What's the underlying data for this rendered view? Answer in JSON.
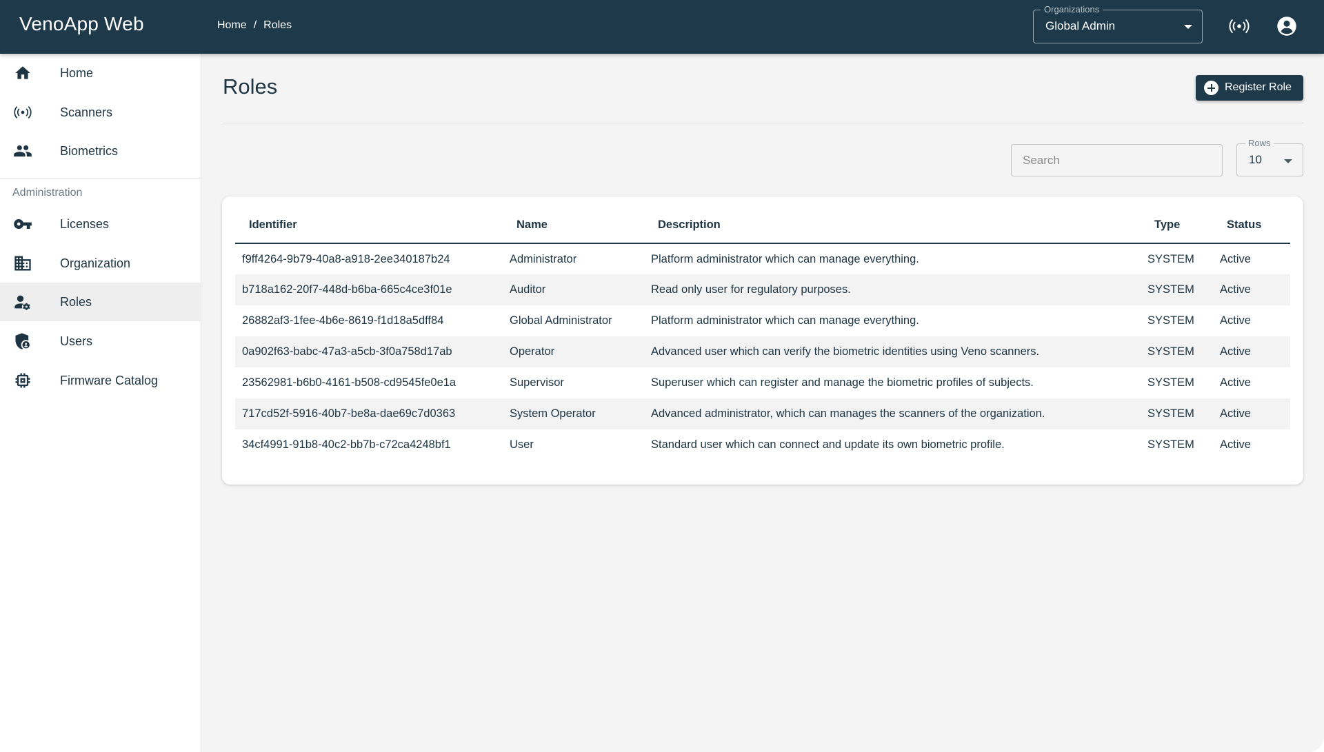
{
  "app": {
    "title": "VenoApp Web"
  },
  "breadcrumb": {
    "items": [
      "Home",
      "Roles"
    ],
    "separator": "/"
  },
  "org_select": {
    "legend": "Organizations",
    "value": "Global Admin"
  },
  "topbar_icons": [
    "scanner-signal-icon",
    "account-circle-icon"
  ],
  "sidebar": {
    "items": [
      {
        "label": "Home",
        "icon": "home-icon"
      },
      {
        "label": "Scanners",
        "icon": "scanner-signal-icon"
      },
      {
        "label": "Biometrics",
        "icon": "people-icon"
      }
    ],
    "section_label": "Administration",
    "admin_items": [
      {
        "label": "Licenses",
        "icon": "key-icon"
      },
      {
        "label": "Organization",
        "icon": "building-icon"
      },
      {
        "label": "Roles",
        "icon": "user-gear-icon",
        "active": true
      },
      {
        "label": "Users",
        "icon": "shield-user-icon"
      },
      {
        "label": "Firmware Catalog",
        "icon": "chip-icon"
      }
    ]
  },
  "page": {
    "title": "Roles",
    "register_button": "Register Role",
    "search_placeholder": "Search",
    "rows_legend": "Rows",
    "rows_value": "10"
  },
  "table": {
    "headers": [
      "Identifier",
      "Name",
      "Description",
      "Type",
      "Status"
    ],
    "rows": [
      [
        "f9ff4264-9b79-40a8-a918-2ee340187b24",
        "Administrator",
        "Platform administrator which can manage everything.",
        "SYSTEM",
        "Active"
      ],
      [
        "b718a162-20f7-448d-b6ba-665c4ce3f01e",
        "Auditor",
        "Read only user for regulatory purposes.",
        "SYSTEM",
        "Active"
      ],
      [
        "26882af3-1fee-4b6e-8619-f1d18a5dff84",
        "Global Administrator",
        "Platform administrator which can manage everything.",
        "SYSTEM",
        "Active"
      ],
      [
        "0a902f63-babc-47a3-a5cb-3f0a758d17ab",
        "Operator",
        "Advanced user which can verify the biometric identities using Veno scanners.",
        "SYSTEM",
        "Active"
      ],
      [
        "23562981-b6b0-4161-b508-cd9545fe0e1a",
        "Supervisor",
        "Superuser which can register and manage the biometric profiles of subjects.",
        "SYSTEM",
        "Active"
      ],
      [
        "717cd52f-5916-40b7-be8a-dae69c7d0363",
        "System Operator",
        "Advanced administrator, which can manages the scanners of the organization.",
        "SYSTEM",
        "Active"
      ],
      [
        "34cf4991-91b8-40c2-bb7b-c72ca4248bf1",
        "User",
        "Standard user which can connect and update its own biometric profile.",
        "SYSTEM",
        "Active"
      ]
    ]
  },
  "colors": {
    "primary": "#1e3a4a",
    "background": "#f4f4f4",
    "text": "#1e3442"
  }
}
